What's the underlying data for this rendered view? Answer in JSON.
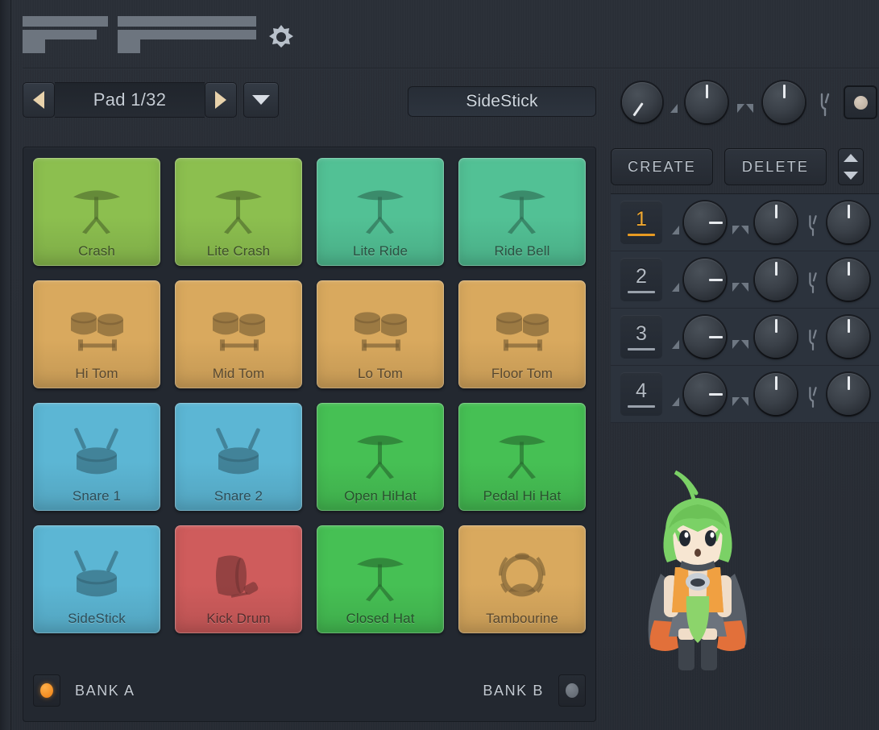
{
  "app": {
    "title": "FPC",
    "logo_text": "FPC",
    "gear_icon": "gear-icon"
  },
  "navbar": {
    "prev_icon": "triangle-left-icon",
    "next_icon": "triangle-right-icon",
    "dropdown_icon": "chevron-down-icon",
    "pad_readout": "Pad 1/32",
    "selected_pad_name": "SideStick"
  },
  "top_controls": {
    "knobs": [
      {
        "name": "pan-knob",
        "angle": -135,
        "style": "line"
      },
      {
        "name": "volume-knob",
        "angle": 0,
        "style": "top"
      },
      {
        "name": "pitch-knob",
        "angle": 0,
        "style": "top"
      }
    ],
    "icons": [
      "triangle-small-icon",
      "triangle-pair-icon",
      "tuning-fork-icon"
    ],
    "mute_button": {
      "name": "link-button",
      "led": "on"
    }
  },
  "right_panel": {
    "create_label": "CREATE",
    "delete_label": "DELETE",
    "spinner_up_icon": "triangle-up-icon",
    "spinner_down_icon": "triangle-down-icon",
    "layers": [
      {
        "number": "1",
        "active": true
      },
      {
        "number": "2",
        "active": false
      },
      {
        "number": "3",
        "active": false
      },
      {
        "number": "4",
        "active": false
      }
    ],
    "layer_knob_icons": [
      "triangle-small-icon",
      "triangle-pair-icon",
      "tuning-fork-icon"
    ],
    "mascot": "mascot-character"
  },
  "pads": [
    {
      "label": "Crash",
      "icon": "cymbal-icon",
      "color": "#8cbf4f"
    },
    {
      "label": "Lite Crash",
      "icon": "cymbal-icon",
      "color": "#8cbf4f"
    },
    {
      "label": "Lite Ride",
      "icon": "cymbal-icon",
      "color": "#52c195"
    },
    {
      "label": "Ride Bell",
      "icon": "cymbal-icon",
      "color": "#52c195"
    },
    {
      "label": "Hi Tom",
      "icon": "tom-icon",
      "color": "#d9a95e"
    },
    {
      "label": "Mid Tom",
      "icon": "tom-icon",
      "color": "#d9a95e"
    },
    {
      "label": "Lo Tom",
      "icon": "tom-icon",
      "color": "#d9a95e"
    },
    {
      "label": "Floor Tom",
      "icon": "tom-icon",
      "color": "#d9a95e"
    },
    {
      "label": "Snare 1",
      "icon": "snare-icon",
      "color": "#5cb6d4"
    },
    {
      "label": "Snare 2",
      "icon": "snare-icon",
      "color": "#5cb6d4"
    },
    {
      "label": "Open HiHat",
      "icon": "cymbal-icon",
      "color": "#46c054"
    },
    {
      "label": "Pedal Hi Hat",
      "icon": "cymbal-icon",
      "color": "#46c054"
    },
    {
      "label": "SideStick",
      "icon": "snare-icon",
      "color": "#5cb6d4"
    },
    {
      "label": "Kick Drum",
      "icon": "kick-icon",
      "color": "#cf5c5c"
    },
    {
      "label": "Closed Hat",
      "icon": "cymbal-icon",
      "color": "#46c054"
    },
    {
      "label": "Tambourine",
      "icon": "tambourine-icon",
      "color": "#d9a95e"
    }
  ],
  "banks": {
    "bank_a_label": "BANK A",
    "bank_a_led": "on",
    "bank_b_label": "BANK B",
    "bank_b_led": "off"
  },
  "colors": {
    "accent_orange": "#ef7f12",
    "layer_active": "#f0a830",
    "panel_bg": "#232830",
    "shell_bg": "#2b3038"
  }
}
